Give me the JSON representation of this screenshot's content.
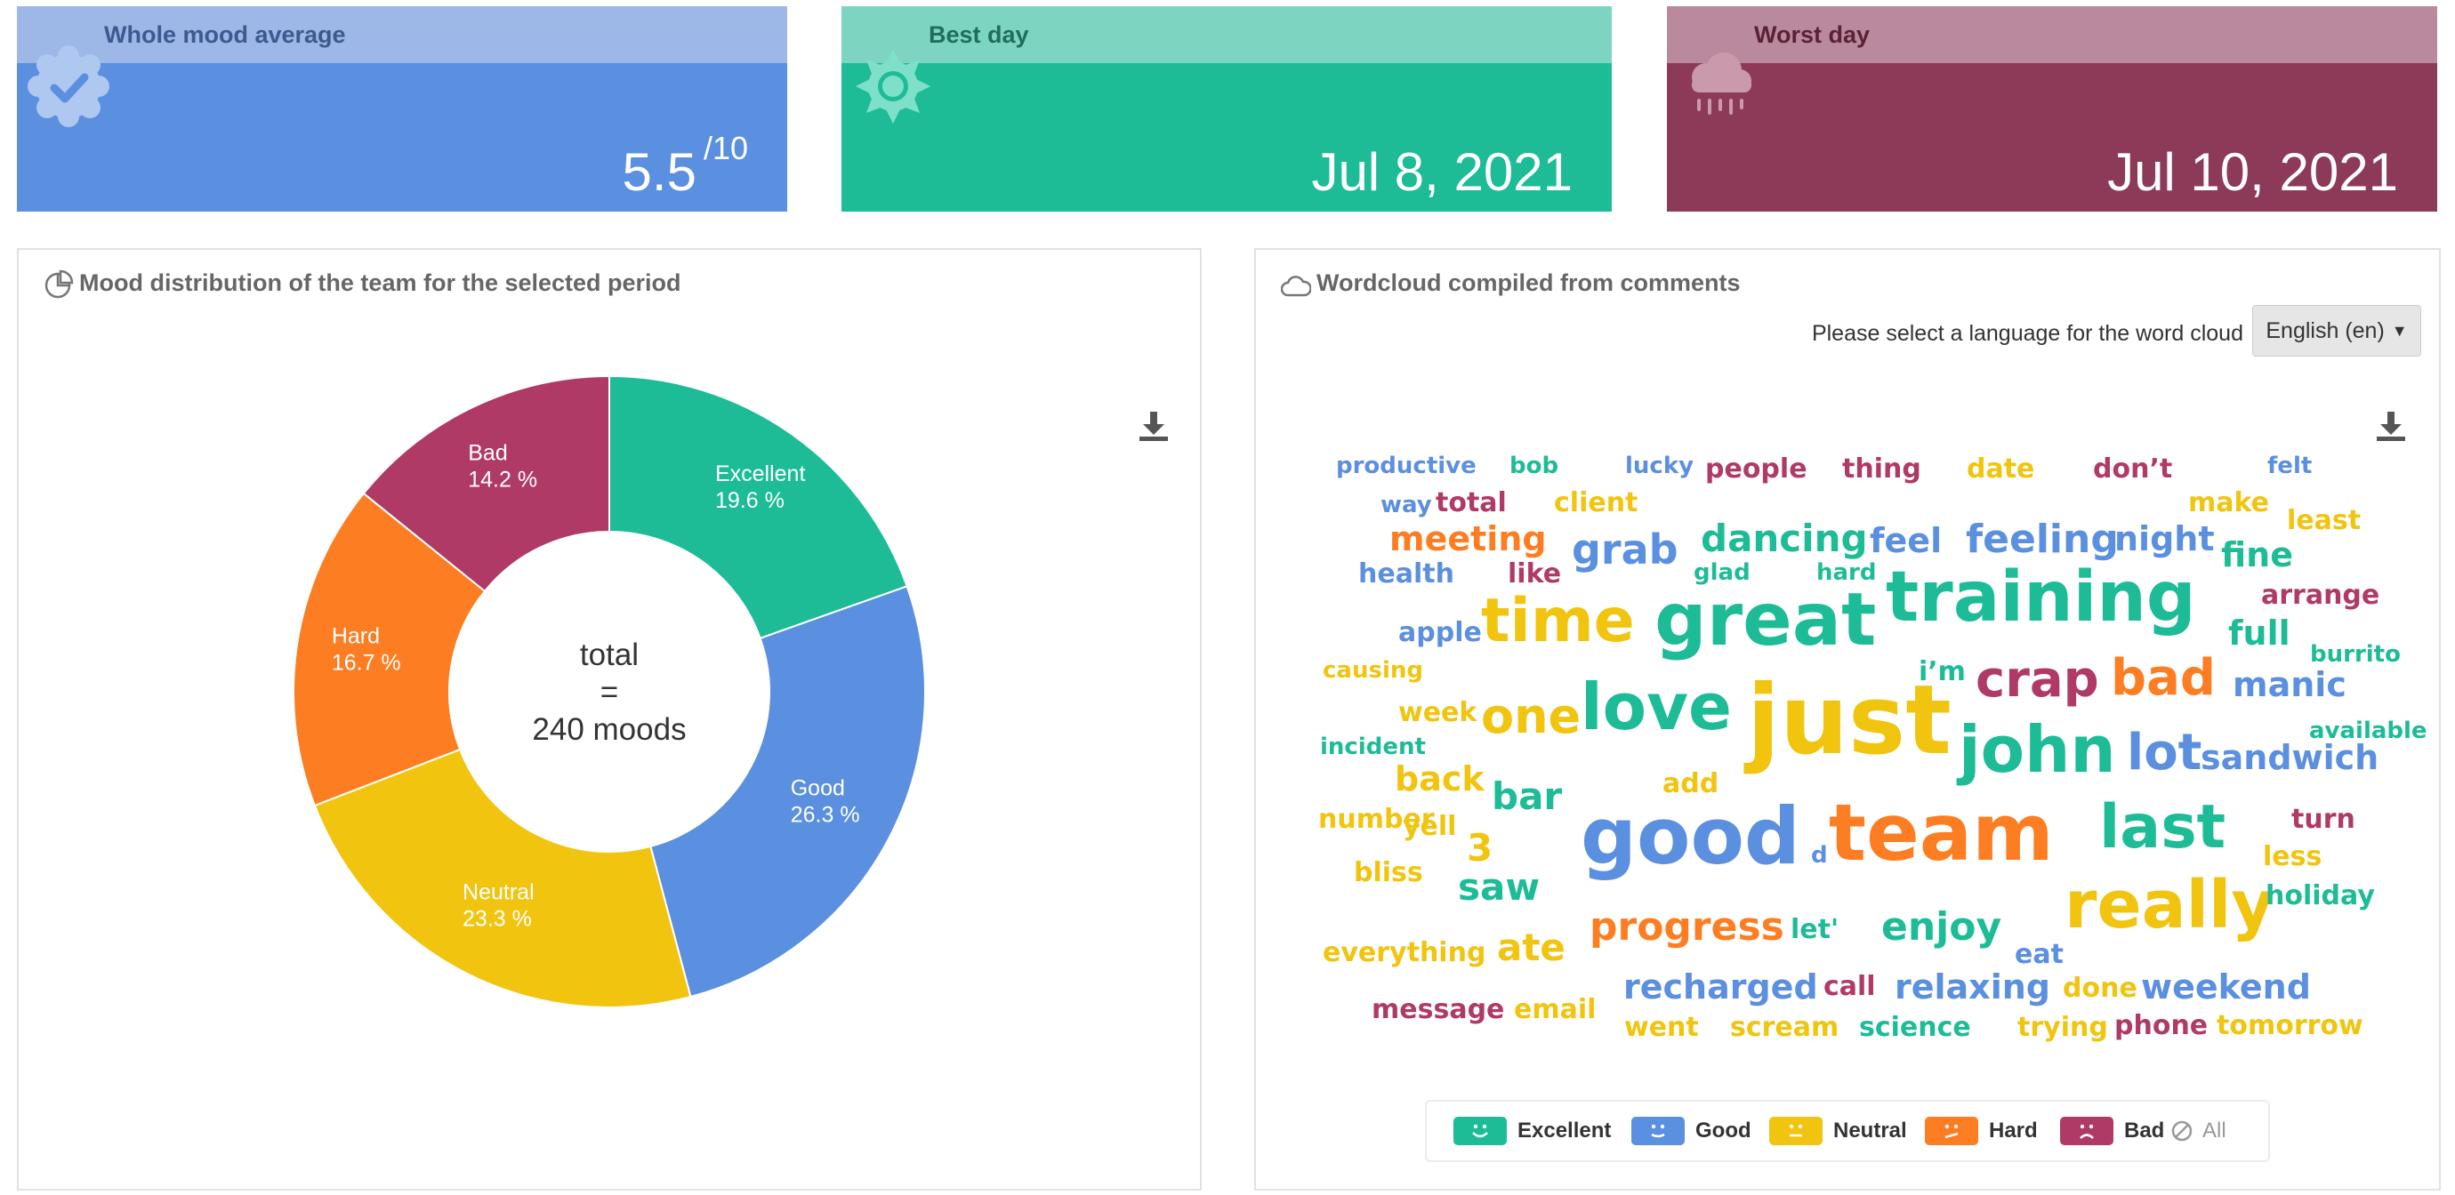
{
  "cards": [
    {
      "label": "Whole mood average",
      "value": "5.5",
      "suffix": "/10",
      "icon": "verified-badge-icon",
      "head_color": "#9db7e6",
      "body_color": "#5b8fdf",
      "label_color": "#3c5a8e"
    },
    {
      "label": "Best day",
      "value": "Jul 8, 2021",
      "suffix": "",
      "icon": "sun-icon",
      "head_color": "#7dd5c1",
      "body_color": "#1dbc97",
      "label_color": "#1f6e5c"
    },
    {
      "label": "Worst day",
      "value": "Jul 10, 2021",
      "suffix": "",
      "icon": "rain-cloud-icon",
      "head_color": "#b98a9e",
      "body_color": "#8c3a57",
      "label_color": "#5a2236"
    }
  ],
  "distribution": {
    "title": "Mood distribution of the team for the selected period",
    "icon": "pie-chart-icon",
    "center_lines": [
      "total",
      "=",
      "240 moods"
    ]
  },
  "chart_data": {
    "type": "pie",
    "title": "Mood distribution of the team for the selected period",
    "total_label": "240 moods",
    "slices": [
      {
        "label": "Excellent",
        "value": 19.6,
        "display": "19.6 %",
        "color": "#1dbc97"
      },
      {
        "label": "Good",
        "value": 26.3,
        "display": "26.3 %",
        "color": "#5b8fdf"
      },
      {
        "label": "Neutral",
        "value": 23.3,
        "display": "23.3 %",
        "color": "#f1c40f"
      },
      {
        "label": "Hard",
        "value": 16.7,
        "display": "16.7 %",
        "color": "#fd7d22"
      },
      {
        "label": "Bad",
        "value": 14.2,
        "display": "14.2 %",
        "color": "#b03a66"
      }
    ]
  },
  "wordcloud": {
    "title": "Wordcloud compiled from comments",
    "icon": "cloud-icon",
    "select_label": "Please select a language for the word cloud",
    "select_value": "English (en)",
    "colors": {
      "excellent": "#1dbc97",
      "good": "#5b8fdf",
      "neutral": "#f1c40f",
      "hard": "#fd7d22",
      "bad": "#b03a66"
    },
    "words": [
      {
        "text": "productive",
        "mood": "good"
      },
      {
        "text": "bob",
        "mood": "excellent"
      },
      {
        "text": "lucky",
        "mood": "good"
      },
      {
        "text": "people",
        "mood": "bad"
      },
      {
        "text": "thing",
        "mood": "bad"
      },
      {
        "text": "date",
        "mood": "neutral"
      },
      {
        "text": "don’t",
        "mood": "bad"
      },
      {
        "text": "felt",
        "mood": "good"
      },
      {
        "text": "way",
        "mood": "good"
      },
      {
        "text": "total",
        "mood": "bad"
      },
      {
        "text": "client",
        "mood": "neutral"
      },
      {
        "text": "make",
        "mood": "neutral"
      },
      {
        "text": "meeting",
        "mood": "hard"
      },
      {
        "text": "least",
        "mood": "neutral"
      },
      {
        "text": "dancing",
        "mood": "excellent"
      },
      {
        "text": "feel",
        "mood": "good"
      },
      {
        "text": "feeling",
        "mood": "good"
      },
      {
        "text": "night",
        "mood": "good"
      },
      {
        "text": "grab",
        "mood": "good"
      },
      {
        "text": "fine",
        "mood": "excellent"
      },
      {
        "text": "health",
        "mood": "good"
      },
      {
        "text": "like",
        "mood": "bad"
      },
      {
        "text": "glad",
        "mood": "excellent"
      },
      {
        "text": "hard",
        "mood": "excellent"
      },
      {
        "text": "training",
        "mood": "excellent"
      },
      {
        "text": "arrange",
        "mood": "bad"
      },
      {
        "text": "time",
        "mood": "neutral"
      },
      {
        "text": "great",
        "mood": "excellent"
      },
      {
        "text": "apple",
        "mood": "good"
      },
      {
        "text": "full",
        "mood": "excellent"
      },
      {
        "text": "burrito",
        "mood": "excellent"
      },
      {
        "text": "causing",
        "mood": "neutral"
      },
      {
        "text": "i’m",
        "mood": "excellent"
      },
      {
        "text": "crap",
        "mood": "bad"
      },
      {
        "text": "bad",
        "mood": "hard"
      },
      {
        "text": "manic",
        "mood": "good"
      },
      {
        "text": "week",
        "mood": "neutral"
      },
      {
        "text": "one",
        "mood": "neutral"
      },
      {
        "text": "love",
        "mood": "excellent"
      },
      {
        "text": "just",
        "mood": "neutral"
      },
      {
        "text": "available",
        "mood": "excellent"
      },
      {
        "text": "incident",
        "mood": "excellent"
      },
      {
        "text": "john",
        "mood": "excellent"
      },
      {
        "text": "lot",
        "mood": "good"
      },
      {
        "text": "sandwich",
        "mood": "good"
      },
      {
        "text": "back",
        "mood": "neutral"
      },
      {
        "text": "add",
        "mood": "neutral"
      },
      {
        "text": "bar",
        "mood": "excellent"
      },
      {
        "text": "number",
        "mood": "neutral"
      },
      {
        "text": "last",
        "mood": "excellent"
      },
      {
        "text": "turn",
        "mood": "bad"
      },
      {
        "text": "yell",
        "mood": "neutral"
      },
      {
        "text": "3",
        "mood": "neutral"
      },
      {
        "text": "good",
        "mood": "good"
      },
      {
        "text": "d",
        "mood": "good"
      },
      {
        "text": "team",
        "mood": "hard"
      },
      {
        "text": "less",
        "mood": "neutral"
      },
      {
        "text": "bliss",
        "mood": "neutral"
      },
      {
        "text": "saw",
        "mood": "excellent"
      },
      {
        "text": "really",
        "mood": "neutral"
      },
      {
        "text": "holiday",
        "mood": "excellent"
      },
      {
        "text": "progress",
        "mood": "hard"
      },
      {
        "text": "let'",
        "mood": "excellent"
      },
      {
        "text": "enjoy",
        "mood": "excellent"
      },
      {
        "text": "everything",
        "mood": "neutral"
      },
      {
        "text": "ate",
        "mood": "neutral"
      },
      {
        "text": "eat",
        "mood": "good"
      },
      {
        "text": "recharged",
        "mood": "good"
      },
      {
        "text": "call",
        "mood": "bad"
      },
      {
        "text": "relaxing",
        "mood": "good"
      },
      {
        "text": "done",
        "mood": "neutral"
      },
      {
        "text": "weekend",
        "mood": "good"
      },
      {
        "text": "message",
        "mood": "bad"
      },
      {
        "text": "email",
        "mood": "neutral"
      },
      {
        "text": "went",
        "mood": "neutral"
      },
      {
        "text": "scream",
        "mood": "neutral"
      },
      {
        "text": "science",
        "mood": "excellent"
      },
      {
        "text": "trying",
        "mood": "neutral"
      },
      {
        "text": "phone",
        "mood": "bad"
      },
      {
        "text": "tomorrow",
        "mood": "neutral"
      }
    ],
    "legend": [
      {
        "label": "Excellent",
        "color": "#1dbc97",
        "face": "smile"
      },
      {
        "label": "Good",
        "color": "#5b8fdf",
        "face": "slight-smile"
      },
      {
        "label": "Neutral",
        "color": "#f1c40f",
        "face": "neutral"
      },
      {
        "label": "Hard",
        "color": "#fd7d22",
        "face": "worried"
      },
      {
        "label": "Bad",
        "color": "#b03a66",
        "face": "frown"
      }
    ],
    "legend_all": "All"
  }
}
